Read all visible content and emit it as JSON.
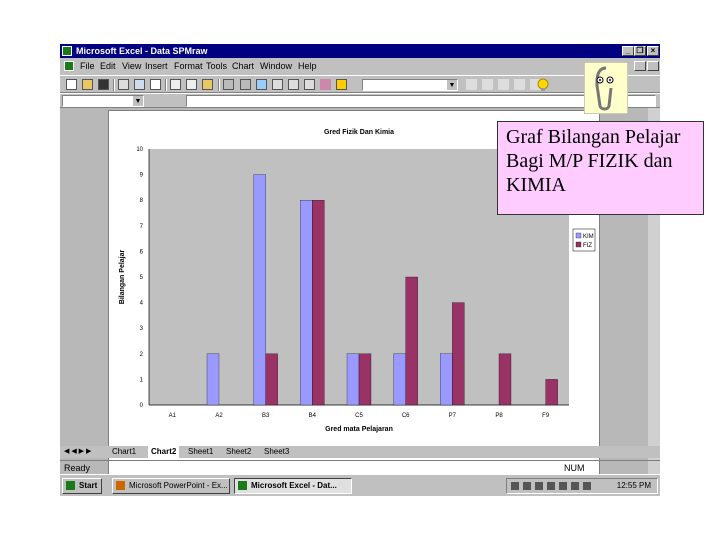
{
  "window": {
    "title": "Microsoft Excel - Data SPMraw",
    "buttons": {
      "minimize": "_",
      "restore": "❐",
      "close": "×"
    }
  },
  "menu": [
    "File",
    "Edit",
    "View",
    "Insert",
    "Format",
    "Tools",
    "Chart",
    "Window",
    "Help"
  ],
  "sheet_tabs": [
    "Chart1",
    "Chart2",
    "Sheet1",
    "Sheet2",
    "Sheet3"
  ],
  "active_tab": "Chart2",
  "status": {
    "left": "Ready",
    "num": "NUM"
  },
  "taskbar": {
    "start": "Start",
    "items": [
      "Microsoft PowerPoint - Ex...",
      "Microsoft Excel - Dat..."
    ],
    "clock": "12:55 PM"
  },
  "callout_text": "Graf Bilangan Pelajar Bagi M/P FIZIK dan KIMIA",
  "chart_data": {
    "type": "bar",
    "title": "Gred Fizik Dan Kimia",
    "xlabel": "Gred mata Pelajaran",
    "ylabel": "Bilangan Pelajar",
    "categories": [
      "A1",
      "A2",
      "B3",
      "B4",
      "C5",
      "C6",
      "P7",
      "P8",
      "F9"
    ],
    "ylim": [
      0,
      10
    ],
    "yticks": [
      "0",
      "1",
      "2",
      "3",
      "4",
      "5",
      "6",
      "7",
      "8",
      "9",
      "10"
    ],
    "series": [
      {
        "name": "KIM",
        "values": [
          0,
          2,
          9,
          8,
          2,
          2,
          2,
          0,
          0
        ]
      },
      {
        "name": "FIZ",
        "values": [
          0,
          0,
          2,
          8,
          2,
          5,
          4,
          2,
          1
        ]
      }
    ],
    "colors": [
      "#9999ff",
      "#993366"
    ],
    "legend": "right",
    "plot_bg": "#c0c0c0"
  }
}
